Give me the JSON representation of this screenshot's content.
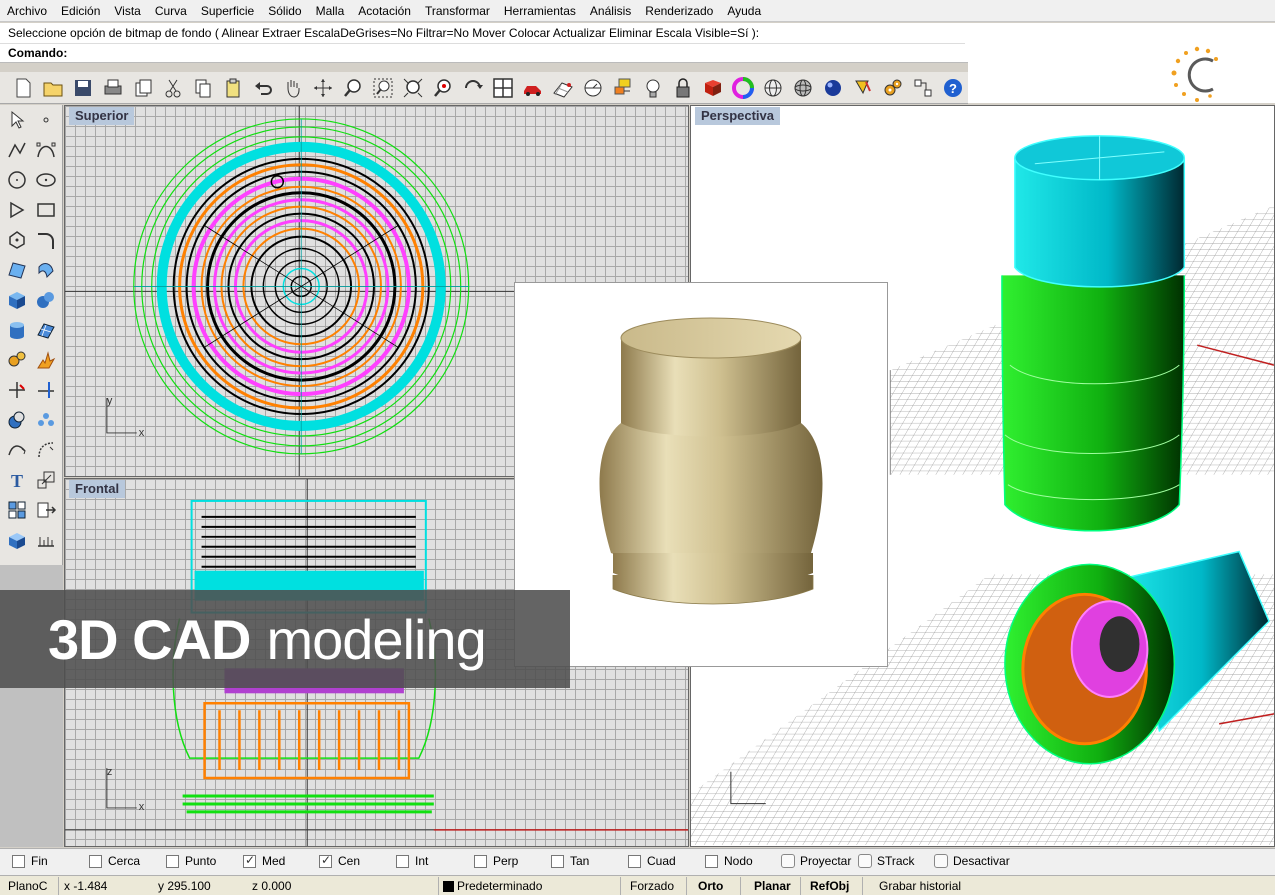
{
  "menu": [
    "Archivo",
    "Edición",
    "Vista",
    "Curva",
    "Superficie",
    "Sólido",
    "Malla",
    "Acotación",
    "Transformar",
    "Herramientas",
    "Análisis",
    "Renderizado",
    "Ayuda"
  ],
  "command": {
    "history": "Seleccione opción de bitmap de fondo ( Alinear  Extraer  EscalaDeGrises=No  Filtrar=No  Mover  Colocar  Actualizar  Eliminar  Escala  Visible=Sí ):",
    "prompt_label": "Comando:",
    "input_value": ""
  },
  "toolbar_icons": [
    "new-file-icon",
    "open-folder-icon",
    "save-icon",
    "print-icon",
    "copy-paste-icon",
    "cut-icon",
    "copy-icon",
    "paste-icon",
    "undo-icon",
    "pan-hand-icon",
    "rotate-view-icon",
    "zoom-icon",
    "zoom-window-icon",
    "zoom-extents-icon",
    "zoom-selected-icon",
    "rotate-icon",
    "four-viewports-icon",
    "car-icon",
    "grid-plane-icon",
    "cplane-icon",
    "layer-icon",
    "light-bulb-icon",
    "lock-icon",
    "shaded-mode-icon",
    "color-wheel-icon",
    "wireframe-sphere-icon",
    "render-sphere-icon",
    "rendered-ball-icon",
    "paint-bucket-icon",
    "settings-gears-icon",
    "tools-icon",
    "help-icon"
  ],
  "viewports": {
    "superior": "Superior",
    "frontal": "Frontal",
    "perspectiva": "Perspectiva"
  },
  "axis_labels": {
    "superior_x": "x",
    "superior_y": "y",
    "frontal_x": "x",
    "frontal_z": "z"
  },
  "banner": {
    "bold": "3D CAD",
    "light": "modeling"
  },
  "osnaps": [
    {
      "label": "Fin",
      "checked": false
    },
    {
      "label": "Cerca",
      "checked": false
    },
    {
      "label": "Punto",
      "checked": false
    },
    {
      "label": "Med",
      "checked": true
    },
    {
      "label": "Cen",
      "checked": true
    },
    {
      "label": "Int",
      "checked": false
    },
    {
      "label": "Perp",
      "checked": false
    },
    {
      "label": "Tan",
      "checked": false
    },
    {
      "label": "Cuad",
      "checked": false
    },
    {
      "label": "Nodo",
      "checked": false
    },
    {
      "label": "Proyectar",
      "checked": false
    },
    {
      "label": "STrack",
      "checked": false
    },
    {
      "label": "Desactivar",
      "checked": false
    }
  ],
  "status": {
    "cplane": "PlanoC",
    "x": "x -1.484",
    "y": "y 295.100",
    "z": "z 0.000",
    "layer": "Predeterminado",
    "layer_color": "#000000",
    "forzado": "Forzado",
    "orto": "Orto",
    "planar": "Planar",
    "refobj": "RefObj",
    "history": "Grabar historial"
  },
  "colors": {
    "accent_orange": "#f0a020",
    "cyan": "#00e0e0",
    "green": "#10e010",
    "magenta": "#ff40ff",
    "orange": "#ff8000",
    "gold_render": "#c9b98a"
  }
}
